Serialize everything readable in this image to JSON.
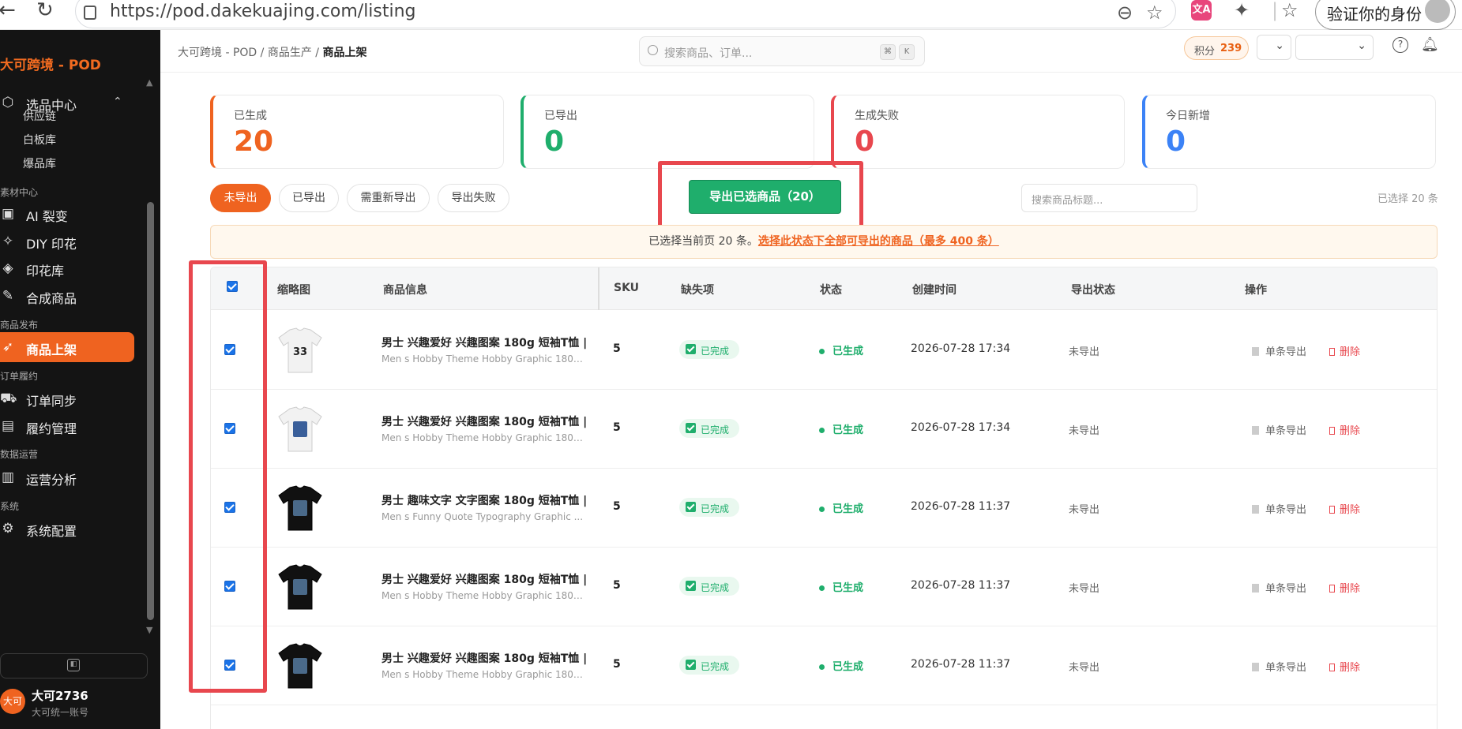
{
  "browser": {
    "url": "https://pod.dakekuajing.com/listing",
    "verify_label": "验证你的身份"
  },
  "sidebar": {
    "logo": "大可跨境 - POD",
    "group_selection": "选品中心",
    "sub_items": [
      "供应链",
      "白板库",
      "爆品库"
    ],
    "group_material": "素材中心",
    "material_items": [
      "AI 裂变",
      "DIY 印花",
      "印花库",
      "合成商品"
    ],
    "group_publish": "商品发布",
    "publish_item": "商品上架",
    "group_order": "订单履约",
    "order_items": [
      "订单同步",
      "履约管理"
    ],
    "group_data": "数据运营",
    "data_item": "运营分析",
    "group_system": "系统",
    "system_item": "系统配置",
    "user_avatar": "大可",
    "user_name": "大可2736",
    "user_sub": "大可统一账号"
  },
  "topbar": {
    "crumb1": "大可跨境 - POD",
    "crumb2": "商品生产",
    "crumb3": "商品上架",
    "search_placeholder": "搜索商品、订单...",
    "kbd1": "⌘",
    "kbd2": "K",
    "points_label": "积分",
    "points_value": "239"
  },
  "stats": [
    {
      "label": "已生成",
      "value": "20",
      "color": "#ef6320"
    },
    {
      "label": "已导出",
      "value": "0",
      "color": "#1fae6c"
    },
    {
      "label": "生成失败",
      "value": "0",
      "color": "#e8474e"
    },
    {
      "label": "今日新增",
      "value": "0",
      "color": "#3b82f6"
    }
  ],
  "tabs": [
    "未导出",
    "已导出",
    "需重新导出",
    "导出失败"
  ],
  "export_button": "导出已选商品（20）",
  "title_search_placeholder": "搜索商品标题...",
  "selected_count": "已选择 20 条",
  "notice": {
    "text": "已选择当前页 20 条。",
    "link": "选择此状态下全部可导出的商品（最多 400 条）"
  },
  "table": {
    "headers": [
      "缩略图",
      "商品信息",
      "SKU",
      "缺失项",
      "状态",
      "创建时间",
      "导出状态",
      "操作"
    ],
    "rows": [
      {
        "name": "男士 兴趣爱好 兴趣图案 180g 短袖T恤 |",
        "sub": "Men s Hobby Theme Hobby Graphic 180g...",
        "sku": "5",
        "missing": "已完成",
        "status": "已生成",
        "time": "2026-07-28 17:34",
        "export": "未导出",
        "act1": "单条导出",
        "act2": "删除",
        "shirt": "white",
        "print": "33"
      },
      {
        "name": "男士 兴趣爱好 兴趣图案 180g 短袖T恤 |",
        "sub": "Men s Hobby Theme Hobby Graphic 180g...",
        "sku": "5",
        "missing": "已完成",
        "status": "已生成",
        "time": "2026-07-28 17:34",
        "export": "未导出",
        "act1": "单条导出",
        "act2": "删除",
        "shirt": "white",
        "print": ""
      },
      {
        "name": "男士 趣味文字 文字图案 180g 短袖T恤 |",
        "sub": "Men s Funny Quote Typography Graphic ...",
        "sku": "5",
        "missing": "已完成",
        "status": "已生成",
        "time": "2026-07-28 11:37",
        "export": "未导出",
        "act1": "单条导出",
        "act2": "删除",
        "shirt": "black",
        "print": ""
      },
      {
        "name": "男士 兴趣爱好 兴趣图案 180g 短袖T恤 |",
        "sub": "Men s Hobby Theme Hobby Graphic 180g...",
        "sku": "5",
        "missing": "已完成",
        "status": "已生成",
        "time": "2026-07-28 11:37",
        "export": "未导出",
        "act1": "单条导出",
        "act2": "删除",
        "shirt": "black",
        "print": ""
      },
      {
        "name": "男士 兴趣爱好 兴趣图案 180g 短袖T恤 |",
        "sub": "Men s Hobby Theme Hobby Graphic 180g...",
        "sku": "5",
        "missing": "已完成",
        "status": "已生成",
        "time": "2026-07-28 11:37",
        "export": "未导出",
        "act1": "单条导出",
        "act2": "删除",
        "shirt": "black",
        "print": ""
      }
    ]
  }
}
